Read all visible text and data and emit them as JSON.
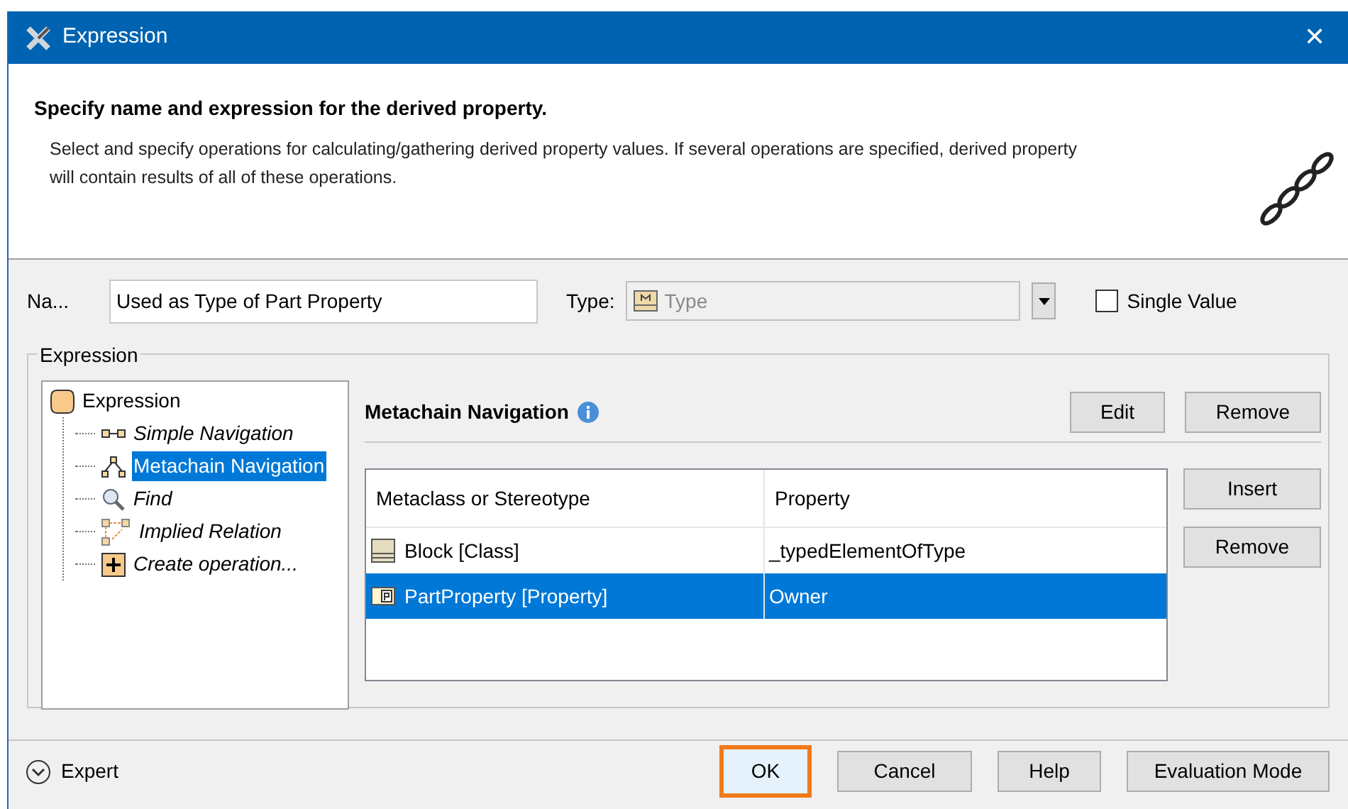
{
  "window": {
    "title": "Expression",
    "close": "✕"
  },
  "header": {
    "title": "Specify name and expression for the derived property.",
    "description": "Select and specify operations for calculating/gathering derived property values. If several operations are specified, derived property will contain results of all of these operations."
  },
  "name_field": {
    "label": "Na...",
    "value": "Used as Type of Part Property"
  },
  "type_field": {
    "label": "Type:",
    "value": "Type",
    "disabled": true
  },
  "single_value": {
    "label": "Single Value",
    "checked": false
  },
  "expression_group": {
    "title": "Expression"
  },
  "tree": {
    "root": {
      "label": "Expression",
      "kind": "root",
      "italic": false,
      "selected": false,
      "children": [
        {
          "label": "Simple Navigation",
          "kind": "simple",
          "italic": true,
          "selected": false
        },
        {
          "label": "Metachain Navigation",
          "kind": "metachain",
          "italic": false,
          "selected": true
        },
        {
          "label": "Find",
          "kind": "find",
          "italic": true,
          "selected": false
        },
        {
          "label": "Implied Relation",
          "kind": "implied",
          "italic": true,
          "selected": false
        },
        {
          "label": "Create operation...",
          "kind": "create",
          "italic": true,
          "selected": false
        }
      ]
    }
  },
  "panel": {
    "title": "Metachain Navigation",
    "buttons": [
      "Edit",
      "Remove"
    ]
  },
  "table": {
    "columns": [
      "Metaclass or Stereotype",
      "Property"
    ],
    "rows": [
      {
        "kind": "block",
        "cells": [
          "Block [Class]",
          "_typedElementOfType"
        ],
        "selected": false
      },
      {
        "kind": "part",
        "cells": [
          "PartProperty [Property]",
          "Owner"
        ],
        "selected": true
      }
    ]
  },
  "table_buttons": [
    "Insert",
    "Remove"
  ],
  "expert": {
    "label": "Expert",
    "expanded": false
  },
  "footer_buttons": [
    {
      "label": "OK",
      "default": true
    },
    {
      "label": "Cancel",
      "default": false
    },
    {
      "label": "Help",
      "default": false
    },
    {
      "label": "Evaluation Mode",
      "default": false
    }
  ]
}
